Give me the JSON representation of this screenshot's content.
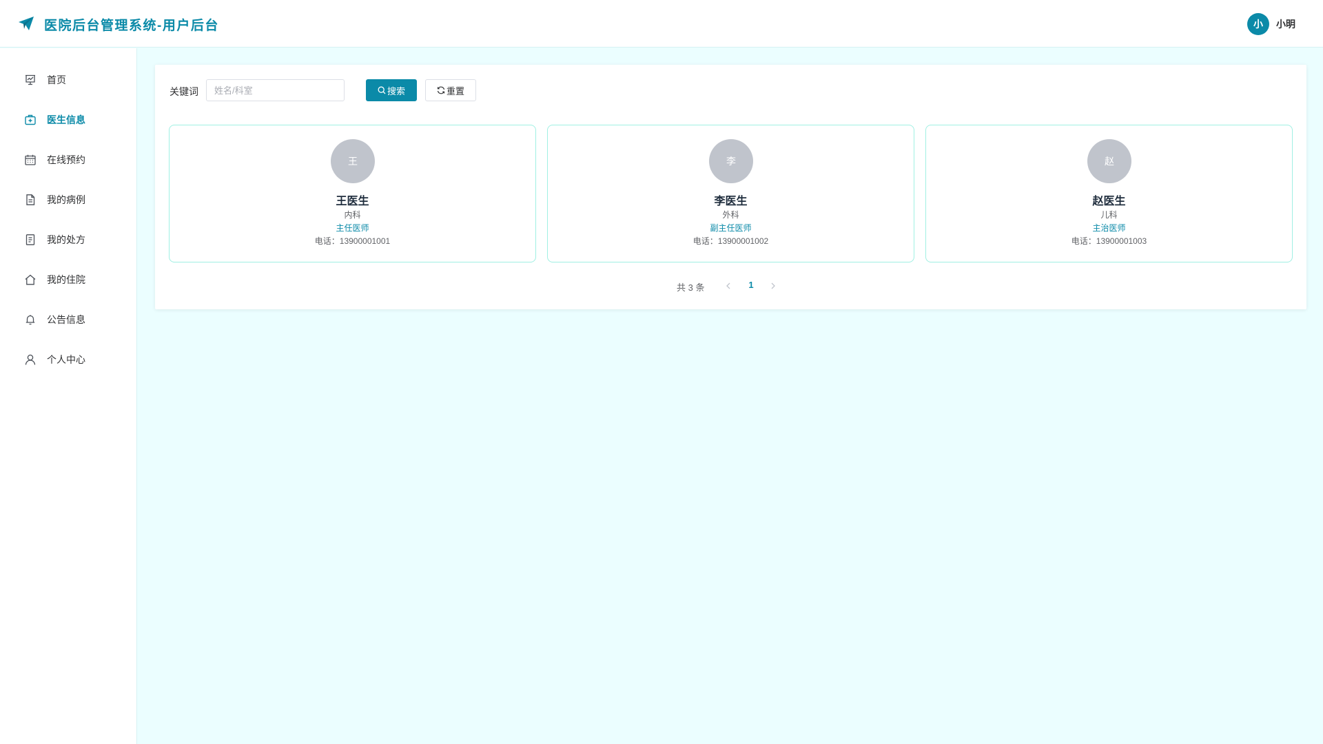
{
  "header": {
    "title": "医院后台管理系统-用户后台",
    "logo_icon": "paper-plane-icon",
    "user": {
      "avatar_text": "小",
      "name": "小明"
    }
  },
  "sidebar": {
    "items": [
      {
        "label": "首页",
        "icon": "chart-board-icon",
        "active": false
      },
      {
        "label": "医生信息",
        "icon": "medical-kit-icon",
        "active": true
      },
      {
        "label": "在线预约",
        "icon": "calendar-icon",
        "active": false
      },
      {
        "label": "我的病例",
        "icon": "document-icon",
        "active": false
      },
      {
        "label": "我的处方",
        "icon": "prescription-icon",
        "active": false
      },
      {
        "label": "我的住院",
        "icon": "house-icon",
        "active": false
      },
      {
        "label": "公告信息",
        "icon": "bell-icon",
        "active": false
      },
      {
        "label": "个人中心",
        "icon": "user-icon",
        "active": false
      }
    ]
  },
  "search": {
    "label": "关键词",
    "placeholder": "姓名/科室",
    "value": "",
    "search_button": "搜索",
    "reset_button": "重置"
  },
  "doctors": [
    {
      "avatar_text": "王",
      "name": "王医生",
      "department": "内科",
      "title": "主任医师",
      "phone": "电话：13900001001"
    },
    {
      "avatar_text": "李",
      "name": "李医生",
      "department": "外科",
      "title": "副主任医师",
      "phone": "电话：13900001002"
    },
    {
      "avatar_text": "赵",
      "name": "赵医生",
      "department": "儿科",
      "title": "主治医师",
      "phone": "电话：13900001003"
    }
  ],
  "pagination": {
    "total_text": "共 3 条",
    "current_page": "1"
  },
  "colors": {
    "accent": "#0b8aa8",
    "background": "#ebfeff",
    "card_border": "#9ff0e3",
    "avatar_gray": "#c0c4cc"
  }
}
